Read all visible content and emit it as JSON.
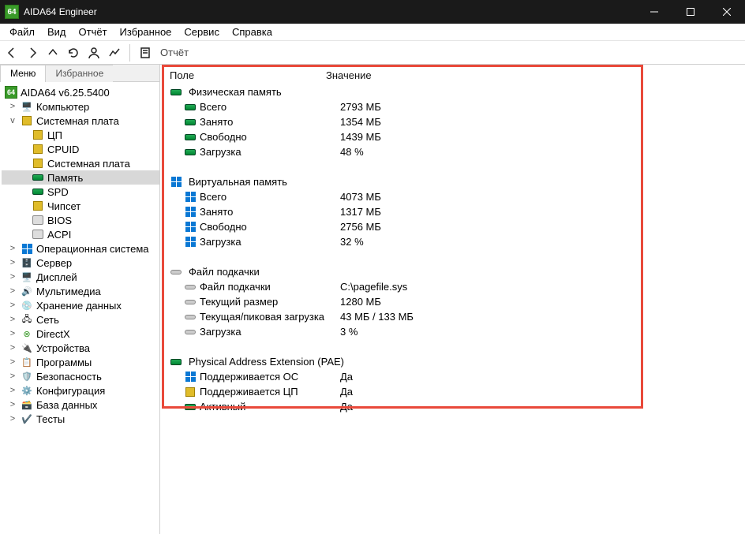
{
  "window": {
    "title": "AIDA64 Engineer",
    "app_icon_text": "64"
  },
  "menubar": [
    "Файл",
    "Вид",
    "Отчёт",
    "Избранное",
    "Сервис",
    "Справка"
  ],
  "toolbar": {
    "report_label": "Отчёт"
  },
  "side_tabs": {
    "menu": "Меню",
    "fav": "Избранное"
  },
  "tree": {
    "root": "AIDA64 v6.25.5400",
    "items": [
      {
        "label": "Компьютер",
        "twisty": ">"
      },
      {
        "label": "Системная плата",
        "twisty": "v",
        "children": [
          {
            "label": "ЦП"
          },
          {
            "label": "CPUID"
          },
          {
            "label": "Системная плата"
          },
          {
            "label": "Память",
            "selected": true
          },
          {
            "label": "SPD"
          },
          {
            "label": "Чипсет"
          },
          {
            "label": "BIOS"
          },
          {
            "label": "ACPI"
          }
        ]
      },
      {
        "label": "Операционная система",
        "twisty": ">"
      },
      {
        "label": "Сервер",
        "twisty": ">"
      },
      {
        "label": "Дисплей",
        "twisty": ">"
      },
      {
        "label": "Мультимедиа",
        "twisty": ">"
      },
      {
        "label": "Хранение данных",
        "twisty": ">"
      },
      {
        "label": "Сеть",
        "twisty": ">"
      },
      {
        "label": "DirectX",
        "twisty": ">"
      },
      {
        "label": "Устройства",
        "twisty": ">"
      },
      {
        "label": "Программы",
        "twisty": ">"
      },
      {
        "label": "Безопасность",
        "twisty": ">"
      },
      {
        "label": "Конфигурация",
        "twisty": ">"
      },
      {
        "label": "База данных",
        "twisty": ">"
      },
      {
        "label": "Тесты",
        "twisty": ">"
      }
    ]
  },
  "details": {
    "header_field": "Поле",
    "header_value": "Значение",
    "groups": [
      {
        "title": "Физическая память",
        "icon": "mem",
        "rows": [
          {
            "icon": "mem",
            "field": "Всего",
            "value": "2793 МБ"
          },
          {
            "icon": "mem",
            "field": "Занято",
            "value": "1354 МБ"
          },
          {
            "icon": "mem",
            "field": "Свободно",
            "value": "1439 МБ"
          },
          {
            "icon": "mem",
            "field": "Загрузка",
            "value": "48 %"
          }
        ]
      },
      {
        "title": "Виртуальная память",
        "icon": "win",
        "rows": [
          {
            "icon": "win",
            "field": "Всего",
            "value": "4073 МБ"
          },
          {
            "icon": "win",
            "field": "Занято",
            "value": "1317 МБ"
          },
          {
            "icon": "win",
            "field": "Свободно",
            "value": "2756 МБ"
          },
          {
            "icon": "win",
            "field": "Загрузка",
            "value": "32 %"
          }
        ]
      },
      {
        "title": "Файл подкачки",
        "icon": "disk",
        "rows": [
          {
            "icon": "disk",
            "field": "Файл подкачки",
            "value": "C:\\pagefile.sys"
          },
          {
            "icon": "disk",
            "field": "Текущий размер",
            "value": "1280 МБ"
          },
          {
            "icon": "disk",
            "field": "Текущая/пиковая загрузка",
            "value": "43 МБ / 133 МБ"
          },
          {
            "icon": "disk",
            "field": "Загрузка",
            "value": "3 %"
          }
        ]
      },
      {
        "title": "Physical Address Extension (PAE)",
        "icon": "mem",
        "rows": [
          {
            "icon": "win",
            "field": "Поддерживается ОС",
            "value": "Да"
          },
          {
            "icon": "cpu",
            "field": "Поддерживается ЦП",
            "value": "Да"
          },
          {
            "icon": "mem",
            "field": "Активный",
            "value": "Да"
          }
        ]
      }
    ]
  }
}
